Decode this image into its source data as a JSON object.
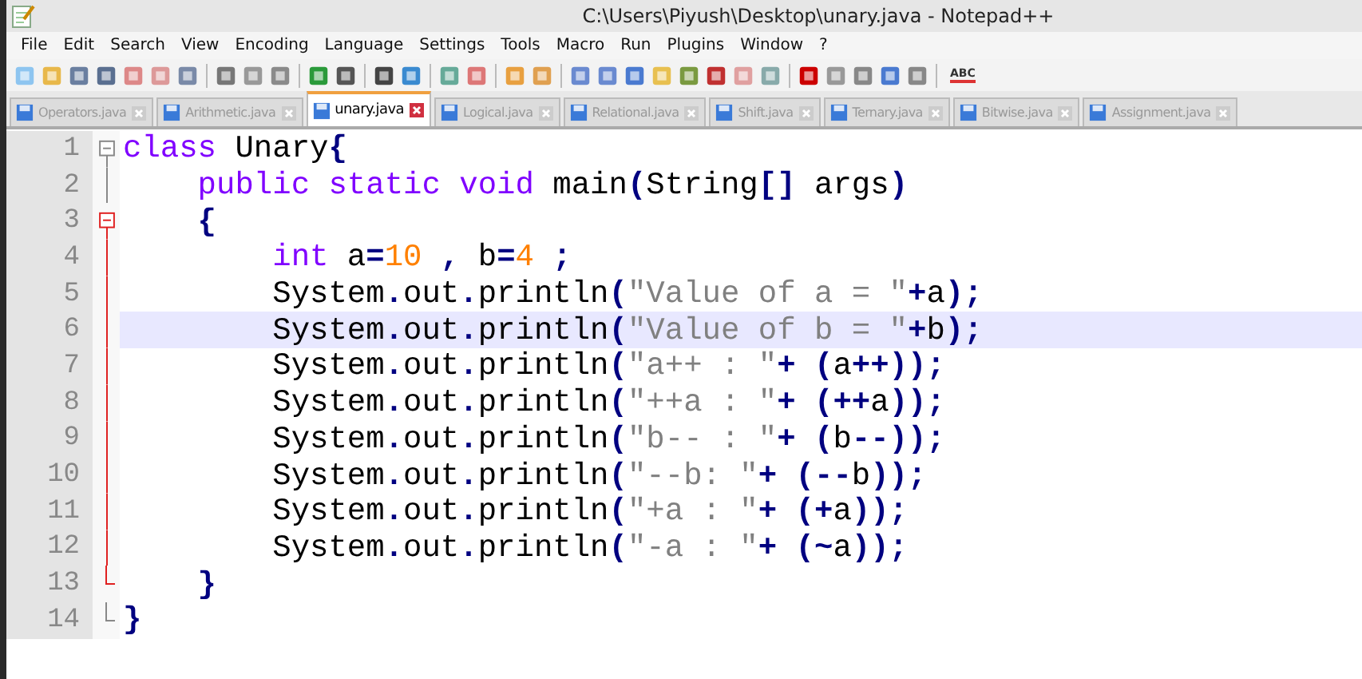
{
  "window": {
    "title": "C:\\Users\\Piyush\\Desktop\\unary.java - Notepad++"
  },
  "menu": [
    "File",
    "Edit",
    "Search",
    "View",
    "Encoding",
    "Language",
    "Settings",
    "Tools",
    "Macro",
    "Run",
    "Plugins",
    "Window",
    "?"
  ],
  "toolbar": {
    "spellcheck_label": "ABC"
  },
  "tabs": [
    {
      "label": "Operators.java",
      "selected": false
    },
    {
      "label": "Arithmetic.java",
      "selected": false
    },
    {
      "label": "unary.java",
      "selected": true
    },
    {
      "label": "Logical.java",
      "selected": false
    },
    {
      "label": "Relational.java",
      "selected": false
    },
    {
      "label": "Shift.java",
      "selected": false
    },
    {
      "label": "Ternary.java",
      "selected": false
    },
    {
      "label": "Bitwise.java",
      "selected": false
    },
    {
      "label": "Assignment.java",
      "selected": false
    }
  ],
  "editor": {
    "lines": [
      {
        "number": "1",
        "fold_start": true,
        "active_block": false,
        "selected": false,
        "tokens": [
          {
            "kind": "kw",
            "text": "class"
          },
          {
            "kind": "txt",
            "text": " Unary"
          },
          {
            "kind": "op",
            "text": "{"
          }
        ]
      },
      {
        "number": "2",
        "fold_start": false,
        "fold_end": false,
        "active_block": false,
        "selected": false,
        "tokens": [
          {
            "kind": "kw",
            "text": "    public static void"
          },
          {
            "kind": "txt",
            "text": " main"
          },
          {
            "kind": "op",
            "text": "("
          },
          {
            "kind": "txt",
            "text": "String"
          },
          {
            "kind": "op",
            "text": "[]"
          },
          {
            "kind": "txt",
            "text": " args"
          },
          {
            "kind": "op",
            "text": ")"
          }
        ]
      },
      {
        "number": "3",
        "fold_start": true,
        "active_block": true,
        "selected": false,
        "tokens": [
          {
            "kind": "op",
            "text": "    {"
          }
        ]
      },
      {
        "number": "4",
        "fold_start": false,
        "fold_end": false,
        "active_block": true,
        "selected": false,
        "tokens": [
          {
            "kind": "kw",
            "text": "        int"
          },
          {
            "kind": "txt",
            "text": " a"
          },
          {
            "kind": "op",
            "text": "="
          },
          {
            "kind": "num",
            "text": "10"
          },
          {
            "kind": "op",
            "text": " ,"
          },
          {
            "kind": "txt",
            "text": " b"
          },
          {
            "kind": "op",
            "text": "="
          },
          {
            "kind": "num",
            "text": "4"
          },
          {
            "kind": "op",
            "text": " ;"
          }
        ]
      },
      {
        "number": "5",
        "fold_start": false,
        "fold_end": false,
        "active_block": true,
        "selected": false,
        "tokens": [
          {
            "kind": "txt",
            "text": "        System"
          },
          {
            "kind": "op",
            "text": "."
          },
          {
            "kind": "txt",
            "text": "out"
          },
          {
            "kind": "op",
            "text": "."
          },
          {
            "kind": "txt",
            "text": "println"
          },
          {
            "kind": "op",
            "text": "("
          },
          {
            "kind": "str",
            "text": "\"Value of a = \""
          },
          {
            "kind": "op",
            "text": "+"
          },
          {
            "kind": "txt",
            "text": "a"
          },
          {
            "kind": "op",
            "text": ");"
          }
        ]
      },
      {
        "number": "6",
        "fold_start": false,
        "fold_end": false,
        "active_block": true,
        "selected": true,
        "tokens": [
          {
            "kind": "txt",
            "text": "        System"
          },
          {
            "kind": "op",
            "text": "."
          },
          {
            "kind": "txt",
            "text": "out"
          },
          {
            "kind": "op",
            "text": "."
          },
          {
            "kind": "txt",
            "text": "println"
          },
          {
            "kind": "op",
            "text": "("
          },
          {
            "kind": "str",
            "text": "\"Value of b = \""
          },
          {
            "kind": "op",
            "text": "+"
          },
          {
            "kind": "txt",
            "text": "b"
          },
          {
            "kind": "op",
            "text": ");"
          }
        ]
      },
      {
        "number": "7",
        "fold_start": false,
        "fold_end": false,
        "active_block": true,
        "selected": false,
        "tokens": [
          {
            "kind": "txt",
            "text": "        System"
          },
          {
            "kind": "op",
            "text": "."
          },
          {
            "kind": "txt",
            "text": "out"
          },
          {
            "kind": "op",
            "text": "."
          },
          {
            "kind": "txt",
            "text": "println"
          },
          {
            "kind": "op",
            "text": "("
          },
          {
            "kind": "str",
            "text": "\"a++ : \""
          },
          {
            "kind": "op",
            "text": "+ ("
          },
          {
            "kind": "txt",
            "text": "a"
          },
          {
            "kind": "op",
            "text": "++));"
          }
        ]
      },
      {
        "number": "8",
        "fold_start": false,
        "fold_end": false,
        "active_block": true,
        "selected": false,
        "tokens": [
          {
            "kind": "txt",
            "text": "        System"
          },
          {
            "kind": "op",
            "text": "."
          },
          {
            "kind": "txt",
            "text": "out"
          },
          {
            "kind": "op",
            "text": "."
          },
          {
            "kind": "txt",
            "text": "println"
          },
          {
            "kind": "op",
            "text": "("
          },
          {
            "kind": "str",
            "text": "\"++a : \""
          },
          {
            "kind": "op",
            "text": "+ (++"
          },
          {
            "kind": "txt",
            "text": "a"
          },
          {
            "kind": "op",
            "text": "));"
          }
        ]
      },
      {
        "number": "9",
        "fold_start": false,
        "fold_end": false,
        "active_block": true,
        "selected": false,
        "tokens": [
          {
            "kind": "txt",
            "text": "        System"
          },
          {
            "kind": "op",
            "text": "."
          },
          {
            "kind": "txt",
            "text": "out"
          },
          {
            "kind": "op",
            "text": "."
          },
          {
            "kind": "txt",
            "text": "println"
          },
          {
            "kind": "op",
            "text": "("
          },
          {
            "kind": "str",
            "text": "\"b-- : \""
          },
          {
            "kind": "op",
            "text": "+ ("
          },
          {
            "kind": "txt",
            "text": "b"
          },
          {
            "kind": "op",
            "text": "--));"
          }
        ]
      },
      {
        "number": "10",
        "fold_start": false,
        "fold_end": false,
        "active_block": true,
        "selected": false,
        "tokens": [
          {
            "kind": "txt",
            "text": "        System"
          },
          {
            "kind": "op",
            "text": "."
          },
          {
            "kind": "txt",
            "text": "out"
          },
          {
            "kind": "op",
            "text": "."
          },
          {
            "kind": "txt",
            "text": "println"
          },
          {
            "kind": "op",
            "text": "("
          },
          {
            "kind": "str",
            "text": "\"--b: \""
          },
          {
            "kind": "op",
            "text": "+ (--"
          },
          {
            "kind": "txt",
            "text": "b"
          },
          {
            "kind": "op",
            "text": "));"
          }
        ]
      },
      {
        "number": "11",
        "fold_start": false,
        "fold_end": false,
        "active_block": true,
        "selected": false,
        "tokens": [
          {
            "kind": "txt",
            "text": "        System"
          },
          {
            "kind": "op",
            "text": "."
          },
          {
            "kind": "txt",
            "text": "out"
          },
          {
            "kind": "op",
            "text": "."
          },
          {
            "kind": "txt",
            "text": "println"
          },
          {
            "kind": "op",
            "text": "("
          },
          {
            "kind": "str",
            "text": "\"+a : \""
          },
          {
            "kind": "op",
            "text": "+ (+"
          },
          {
            "kind": "txt",
            "text": "a"
          },
          {
            "kind": "op",
            "text": "));"
          }
        ]
      },
      {
        "number": "12",
        "fold_start": false,
        "fold_end": false,
        "active_block": true,
        "selected": false,
        "tokens": [
          {
            "kind": "txt",
            "text": "        System"
          },
          {
            "kind": "op",
            "text": "."
          },
          {
            "kind": "txt",
            "text": "out"
          },
          {
            "kind": "op",
            "text": "."
          },
          {
            "kind": "txt",
            "text": "println"
          },
          {
            "kind": "op",
            "text": "("
          },
          {
            "kind": "str",
            "text": "\"-a : \""
          },
          {
            "kind": "op",
            "text": "+ (~"
          },
          {
            "kind": "txt",
            "text": "a"
          },
          {
            "kind": "op",
            "text": "));"
          }
        ]
      },
      {
        "number": "13",
        "fold_start": false,
        "fold_end": true,
        "active_block": true,
        "selected": false,
        "tokens": [
          {
            "kind": "op",
            "text": "    }"
          }
        ]
      },
      {
        "number": "14",
        "fold_start": false,
        "fold_end": true,
        "active_block": false,
        "selected": false,
        "tokens": [
          {
            "kind": "op",
            "text": "}"
          }
        ]
      }
    ]
  }
}
